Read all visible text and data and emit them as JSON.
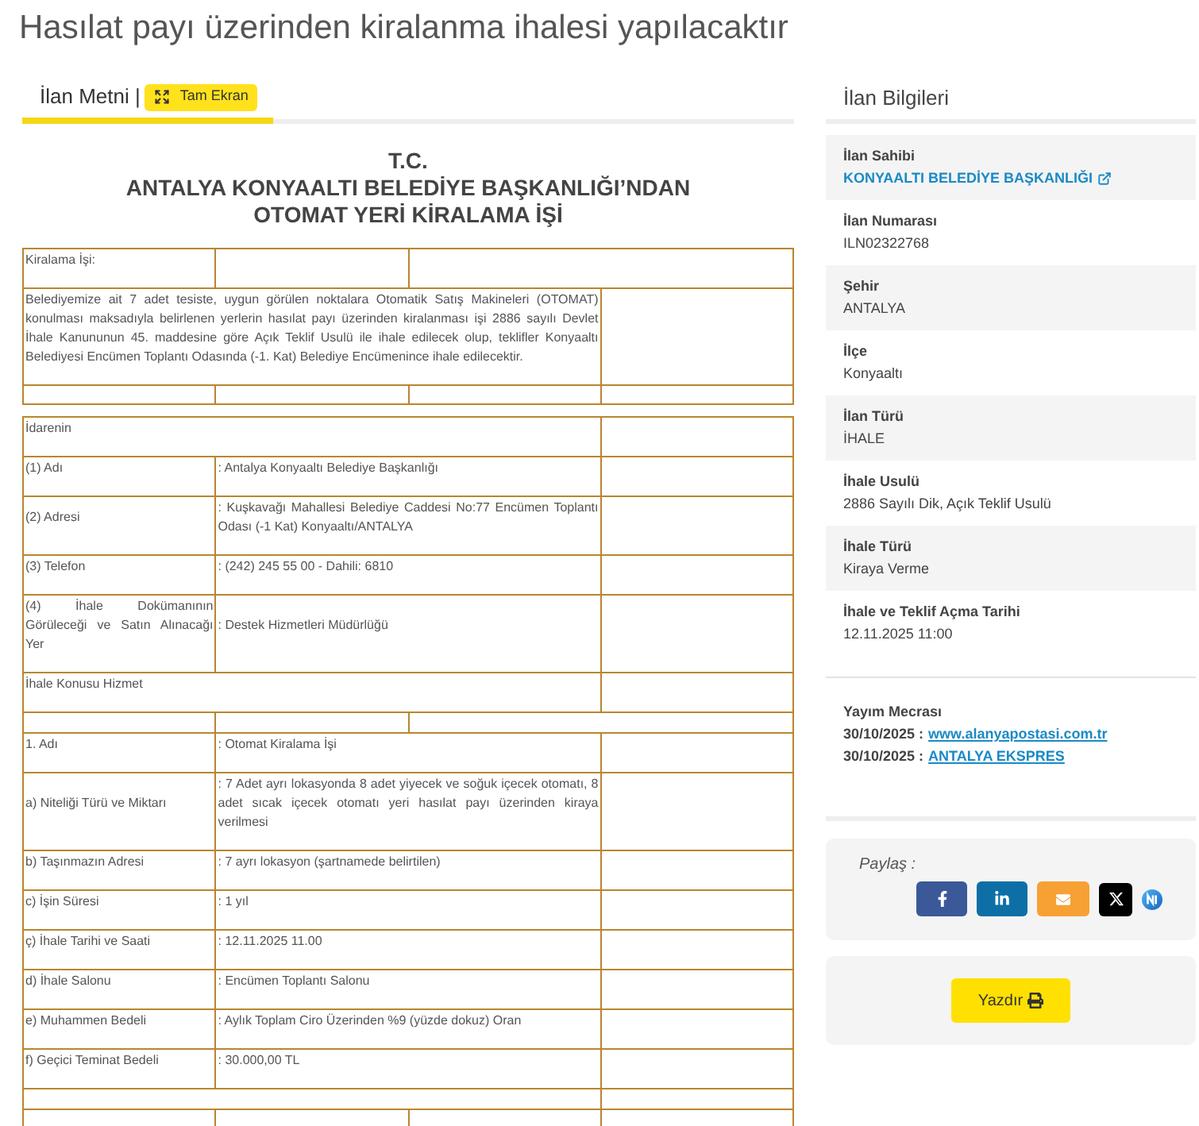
{
  "page_title": "Hasılat payı üzerinden kiralanma ihalesi yapılacaktır",
  "document_panel": {
    "tabs": [
      {
        "label": "İlan Metni |",
        "selected": true
      }
    ],
    "fullscreen_button": "Tam Ekran",
    "heading_lines": [
      "T.C.",
      "ANTALYA KONYAALTI BELEDİYE BAŞKANLIĞI’NDAN",
      "OTOMAT YERİ KİRALAMA İŞİ"
    ],
    "tables": [
      {
        "rows": [
          {
            "kind": "lead",
            "text": "Kiralama İşi:"
          },
          {
            "kind": "wide",
            "text": "Belediyemize ait 7 adet tesiste, uygun görülen noktalara Otomatik Satış Makineleri (OTOMAT) konulması maksadıyla belirlenen yerlerin hasılat payı üzerinden kiralanması işi 2886 sayılı Devlet İhale Kanununun 45. maddesine göre Açık Teklif Usulü ile ihale edilecek olup, teklifler Konyaaltı Belediyesi Encümen Toplantı Odasında (-1. Kat) Belediye Encümenince ihale edilecektir."
          },
          {
            "kind": "spacer"
          }
        ]
      },
      {
        "rows": [
          {
            "kind": "wide",
            "text": "İdarenin"
          },
          {
            "kind": "field",
            "label": "(1) Adı",
            "value": ": Antalya Konyaaltı Belediye Başkanlığı"
          },
          {
            "kind": "field",
            "label": "(2) Adresi",
            "value": ": Kuşkavağı Mahallesi Belediye Caddesi No:77 Encümen Toplantı Odası (-1 Kat) Konyaaltı/ANTALYA"
          },
          {
            "kind": "field",
            "label": "(3) Telefon",
            "value": ": (242) 245 55 00 - Dahili: 6810"
          },
          {
            "kind": "field",
            "label": "(4) İhale Dokümanının Görüleceği ve Satın Alınacağı Yer",
            "value": ": Destek Hizmetleri Müdürlüğü"
          },
          {
            "kind": "wide",
            "text": "İhale Konusu Hizmet"
          },
          {
            "kind": "spacer_split"
          },
          {
            "kind": "field",
            "label": "1. Adı",
            "value": ": Otomat Kiralama İşi"
          },
          {
            "kind": "field",
            "label": "a) Niteliği Türü ve Miktarı",
            "value": ": 7 Adet ayrı lokasyonda 8 adet yiyecek ve soğuk içecek otomatı, 8 adet sıcak içecek otomatı yeri hasılat payı üzerinden kiraya verilmesi"
          },
          {
            "kind": "field",
            "label": "b) Taşınmazın Adresi",
            "value": ": 7 ayrı lokasyon (şartnamede belirtilen)"
          },
          {
            "kind": "field",
            "label": "c) İşin Süresi",
            "value": ": 1 yıl"
          },
          {
            "kind": "field",
            "label": "ç) İhale Tarihi ve Saati",
            "value": ": 12.11.2025 11.00"
          },
          {
            "kind": "field",
            "label": "d) İhale Salonu",
            "value": ": Encümen Toplantı Salonu"
          },
          {
            "kind": "field",
            "label": "e) Muhammen Bedeli",
            "value": ": Aylık Toplam Ciro Üzerinden %9 (yüzde dokuz) Oran"
          },
          {
            "kind": "field",
            "label": "f) Geçici Teminat Bedeli",
            "value": ": 30.000,00 TL"
          },
          {
            "kind": "spacer_wide"
          },
          {
            "kind": "spacer"
          }
        ]
      }
    ]
  },
  "sidebar": {
    "title": "İlan Bilgileri",
    "fields": [
      {
        "label": "İlan Sahibi",
        "value": "KONYAALTI BELEDİYE BAŞKANLIĞI",
        "kind": "link"
      },
      {
        "label": "İlan Numarası",
        "value": "ILN02322768",
        "kind": "text"
      },
      {
        "label": "Şehir",
        "value": "ANTALYA",
        "kind": "text"
      },
      {
        "label": "İlçe",
        "value": "Konyaaltı",
        "kind": "text"
      },
      {
        "label": "İlan Türü",
        "value": "İHALE",
        "kind": "text"
      },
      {
        "label": "İhale Usulü",
        "value": "2886 Sayılı Dik, Açık Teklif Usulü",
        "kind": "text"
      },
      {
        "label": "İhale Türü",
        "value": "Kiraya Verme",
        "kind": "text"
      },
      {
        "label": "İhale ve Teklif Açma Tarihi",
        "value": "12.11.2025 11:00",
        "kind": "text"
      }
    ],
    "publication": {
      "label": "Yayım Mecrası",
      "entries": [
        {
          "date": "30/10/2025 :",
          "link": "www.alanyapostasi.com.tr"
        },
        {
          "date": "30/10/2025 :",
          "link": "ANTALYA EKSPRES"
        }
      ]
    },
    "share": {
      "label": "Paylaş :"
    },
    "print_button": "Yazdır"
  }
}
